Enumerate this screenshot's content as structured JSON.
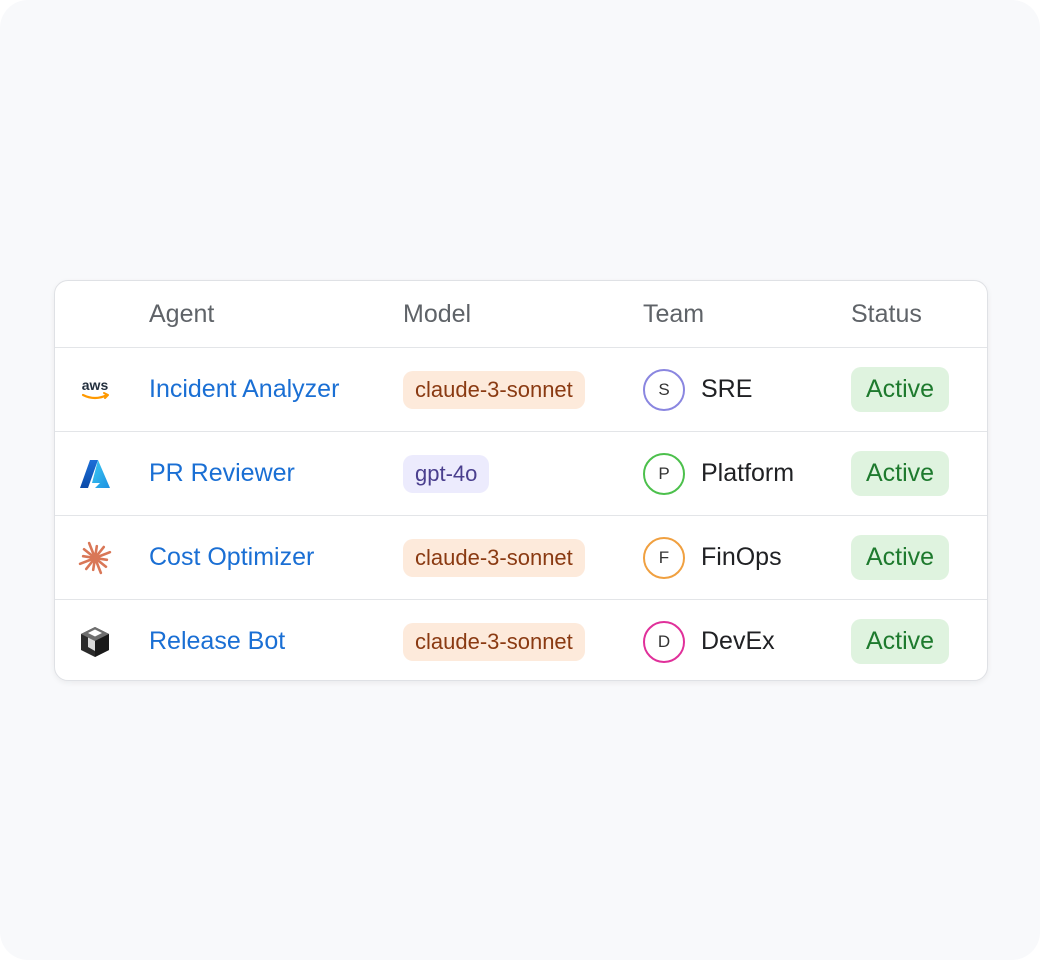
{
  "columns": {
    "agent": "Agent",
    "model": "Model",
    "team": "Team",
    "status": "Status"
  },
  "colors": {
    "link": "#1a6fd4",
    "active_text": "#1e7a2e",
    "active_bg": "#dff3df",
    "claude_badge_bg": "#fdeadb",
    "claude_badge_text": "#8a3a12",
    "gpt_badge_bg": "#ecebfd",
    "gpt_badge_text": "#4a3f8e"
  },
  "rows": [
    {
      "icon": "aws-logo-icon",
      "icon_text": "aws",
      "agent": "Incident Analyzer",
      "model": "claude-3-sonnet",
      "model_family": "claude",
      "team_initial": "S",
      "team": "SRE",
      "team_color": "#8a86e0",
      "status": "Active"
    },
    {
      "icon": "azure-logo-icon",
      "agent": "PR Reviewer",
      "model": "gpt-4o",
      "model_family": "gpt",
      "team_initial": "P",
      "team": "Platform",
      "team_color": "#4cc04c",
      "status": "Active"
    },
    {
      "icon": "claude-starburst-icon",
      "agent": "Cost Optimizer",
      "model": "claude-3-sonnet",
      "model_family": "claude",
      "team_initial": "F",
      "team": "FinOps",
      "team_color": "#f0a040",
      "status": "Active"
    },
    {
      "icon": "cube-logo-icon",
      "agent": "Release Bot",
      "model": "claude-3-sonnet",
      "model_family": "claude",
      "team_initial": "D",
      "team": "DevEx",
      "team_color": "#e0309a",
      "status": "Active"
    }
  ]
}
